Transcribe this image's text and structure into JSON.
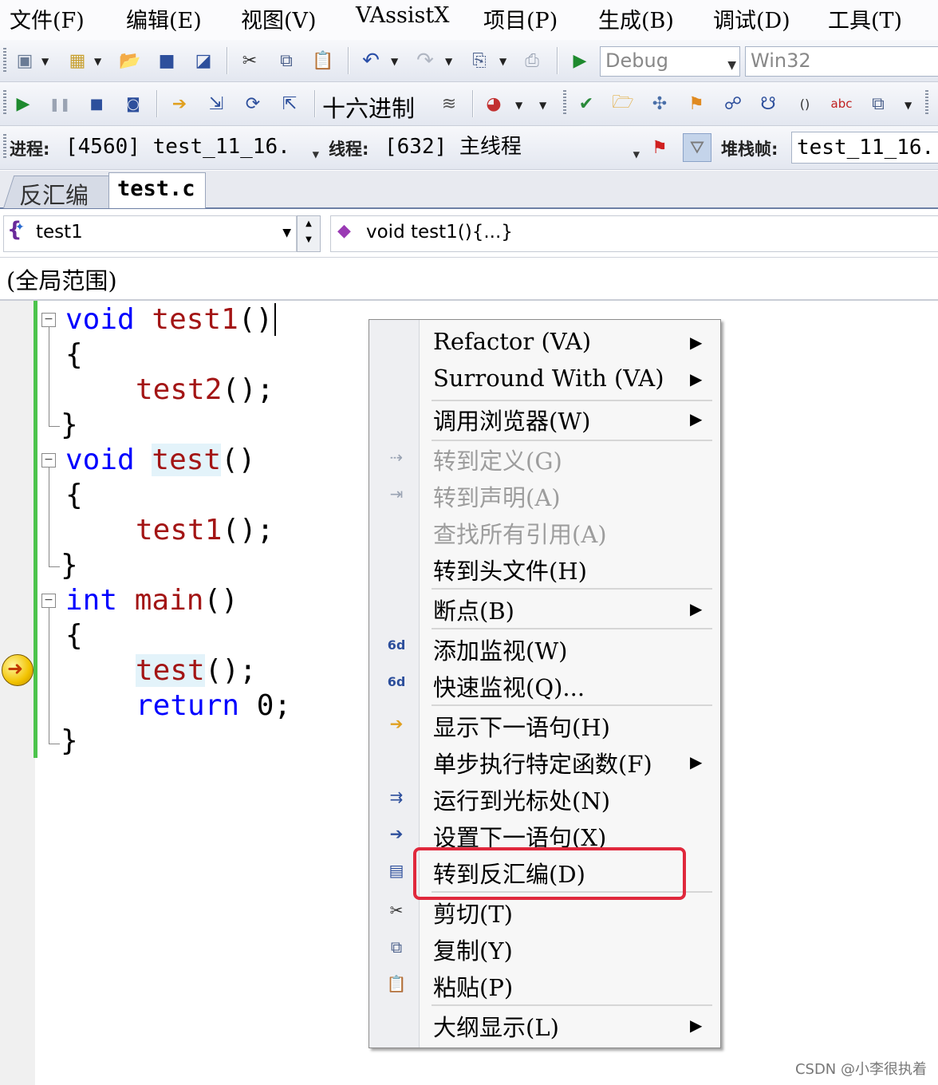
{
  "menubar": [
    "文件(F)",
    "编辑(E)",
    "视图(V)",
    "VAssistX",
    "项目(P)",
    "生成(B)",
    "调试(D)",
    "工具(T)"
  ],
  "toolbar1": {
    "config": "Debug",
    "platform": "Win32"
  },
  "toolbar2": {
    "hex_label": "十六进制"
  },
  "debugbar": {
    "process_label": "进程:",
    "process_value": "[4560] test_11_16.",
    "thread_label": "线程:",
    "thread_value": "[632] 主线程",
    "stackframe_label": "堆栈帧:",
    "stackframe_value": "test_11_16."
  },
  "tabs": [
    "反汇编",
    "test.c"
  ],
  "navbar": {
    "scope_value": "test1",
    "member_value": "void test1(){...}"
  },
  "scope": "(全局范围)",
  "code": {
    "void": "void",
    "int": "int",
    "return": "return",
    "test1": "test1",
    "test2": "test2",
    "test": "test",
    "main": "main",
    "parens": "()",
    "parens_semi": "();",
    "zero_semi": "0;",
    "open_brace": "{",
    "close_brace": "}"
  },
  "context_menu": {
    "items": [
      {
        "label": "Refactor (VA)",
        "submenu": true,
        "disabled": false
      },
      {
        "label": "Surround With (VA)",
        "submenu": true,
        "disabled": false
      },
      {
        "label": "调用浏览器(W)",
        "submenu": true,
        "disabled": false
      },
      {
        "label": "转到定义(G)",
        "submenu": false,
        "disabled": true
      },
      {
        "label": "转到声明(A)",
        "submenu": false,
        "disabled": true
      },
      {
        "label": "查找所有引用(A)",
        "submenu": false,
        "disabled": true
      },
      {
        "label": "转到头文件(H)",
        "submenu": false,
        "disabled": false
      },
      {
        "label": "断点(B)",
        "submenu": true,
        "disabled": false
      },
      {
        "label": "添加监视(W)",
        "submenu": false,
        "disabled": false
      },
      {
        "label": "快速监视(Q)...",
        "submenu": false,
        "disabled": false
      },
      {
        "label": "显示下一语句(H)",
        "submenu": false,
        "disabled": false
      },
      {
        "label": "单步执行特定函数(F)",
        "submenu": true,
        "disabled": false
      },
      {
        "label": "运行到光标处(N)",
        "submenu": false,
        "disabled": false
      },
      {
        "label": "设置下一语句(X)",
        "submenu": false,
        "disabled": false
      },
      {
        "label": "转到反汇编(D)",
        "submenu": false,
        "disabled": false,
        "highlighted": true
      },
      {
        "label": "剪切(T)",
        "submenu": false,
        "disabled": false
      },
      {
        "label": "复制(Y)",
        "submenu": false,
        "disabled": false
      },
      {
        "label": "粘贴(P)",
        "submenu": false,
        "disabled": false
      },
      {
        "label": "大纲显示(L)",
        "submenu": true,
        "disabled": false
      }
    ],
    "submenu_arrow": "▶",
    "highlight_color": "#e0283c"
  },
  "watermark": "CSDN @小李很执着"
}
